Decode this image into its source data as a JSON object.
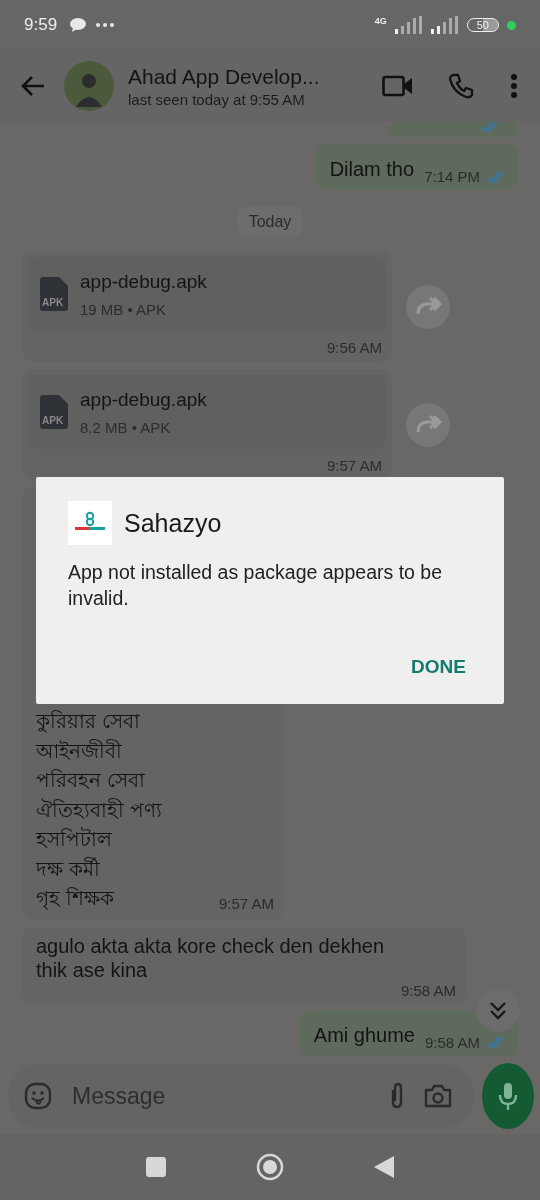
{
  "status_bar": {
    "time": "9:59",
    "network": "4G",
    "battery": "50"
  },
  "header": {
    "name": "Ahad App Develop...",
    "status": "last seen today at 9:55 AM"
  },
  "messages": [
    {
      "kind": "stub",
      "outgoing": true,
      "read": true
    },
    {
      "kind": "text",
      "outgoing": true,
      "text": "Dilam tho",
      "time": "7:14 PM",
      "read": true
    },
    {
      "kind": "date",
      "text": "Today"
    },
    {
      "kind": "file",
      "file_name": "app-debug.apk",
      "file_type": "APK",
      "meta": "19 MB • APK",
      "time": "9:56 AM"
    },
    {
      "kind": "file",
      "file_name": "app-debug.apk",
      "file_type": "APK",
      "meta": "8.2 MB • APK",
      "time": "9:57 AM"
    },
    {
      "kind": "list",
      "outgoing": false,
      "lines": [
        "কুরিয়ার সেবা",
        "আইনজীবী",
        "পরিবহন সেবা",
        "ঐতিহ্যবাহী পণ্য",
        "হসপিটাল",
        "দক্ষ কর্মী",
        "গৃহ শিক্ষক"
      ],
      "time": "9:57 AM"
    },
    {
      "kind": "text",
      "outgoing": false,
      "text": "agulo akta akta kore check den dekhen thik ase kina",
      "time": "9:58 AM"
    },
    {
      "kind": "text",
      "outgoing": true,
      "text": "Ami ghume",
      "time": "9:58 AM",
      "read": true
    }
  ],
  "composer": {
    "placeholder": "Message"
  },
  "dialog": {
    "title": "Sahazyo",
    "message": "App not installed as package appears to be invalid.",
    "button": "DONE"
  }
}
